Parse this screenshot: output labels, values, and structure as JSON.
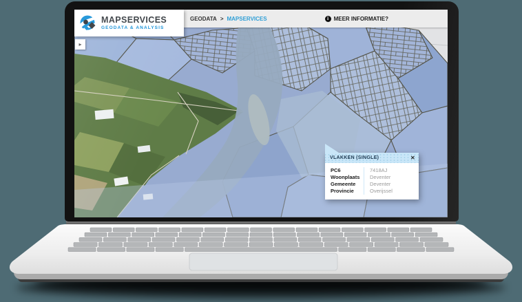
{
  "window": {
    "background_color": "#4e6b74",
    "description": "laptop mockup showing MapServices geodata web application"
  },
  "logo": {
    "title": "MAPSERVICES",
    "subtitle": "GEODATA & ANALYSIS",
    "icon": "mapservices-logo-icon",
    "brand_color": "#1490d8",
    "title_color": "#3a3f44"
  },
  "header": {
    "background_color": "#ececec",
    "breadcrumb": {
      "root": "GEODATA",
      "separator": ">",
      "current": "MAPSERVICES",
      "current_color": "#2f9fd6"
    },
    "info": {
      "icon": "info-icon",
      "icon_glyph": "i",
      "label": "MEER INFORMATIE?"
    }
  },
  "map": {
    "type": "satellite with cadastral parcel overlay, Deventer area",
    "toggle_icon": "chevron-right-icon",
    "toggle_glyph": "▸",
    "overlay_color": "#98abd0",
    "outline_color": "#54544a"
  },
  "popup": {
    "title": "VLAKKEN (SINGLE)",
    "close_icon": "close-icon",
    "close_glyph": "✕",
    "header_color": "#c9e6f8",
    "fields": [
      {
        "label": "PC6",
        "value": "7418AJ"
      },
      {
        "label": "Woonplaats",
        "value": "Deventer"
      },
      {
        "label": "Gemeente",
        "value": "Deventer"
      },
      {
        "label": "Provincie",
        "value": "Overijssel"
      }
    ]
  }
}
